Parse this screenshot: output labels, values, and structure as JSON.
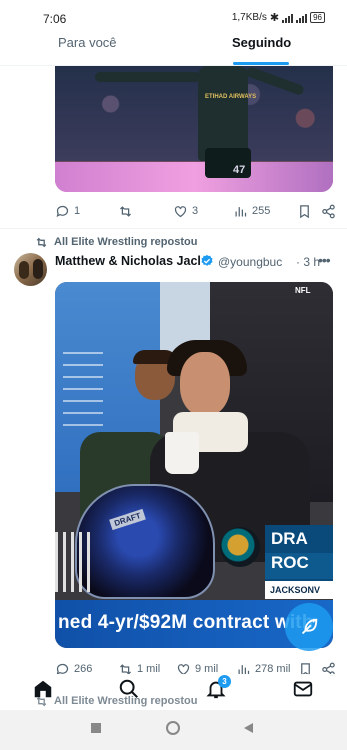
{
  "status_bar": {
    "time": "7:06",
    "network_speed": "1,7KB/s",
    "battery": "96"
  },
  "tabs": {
    "for_you": "Para você",
    "following": "Seguindo",
    "active": "following"
  },
  "tweet1": {
    "media_shirt_text": "ETIHAD AIRWAYS",
    "media_number": "47",
    "replies": "1",
    "reposts": "",
    "likes": "3",
    "views": "255"
  },
  "tweet2": {
    "repost_text": "All Elite Wrestling repostou",
    "author_name": "Matthew & Nicholas Jacl",
    "verified": true,
    "handle": "@youngbuc",
    "time": "· 3 h",
    "media": {
      "nfl_badge": "NFL",
      "helmet_text": "DRAFT",
      "panel_line1": "DRA",
      "panel_line2": "ROC",
      "panel_line3": "JACKSONV",
      "ticker": "ned 4-yr/$92M contract with"
    },
    "replies": "266",
    "reposts": "1 mil",
    "likes": "9 mil",
    "views": "278 mil"
  },
  "next_repost": "All Elite Wrestling repostou",
  "bottom_nav": {
    "notifications_count": "3",
    "items": [
      "home-icon",
      "search-icon",
      "notifications-icon",
      "messages-icon"
    ]
  },
  "colors": {
    "accent": "#1d9bf0",
    "text_primary": "#0f1419",
    "text_secondary": "#536471"
  }
}
